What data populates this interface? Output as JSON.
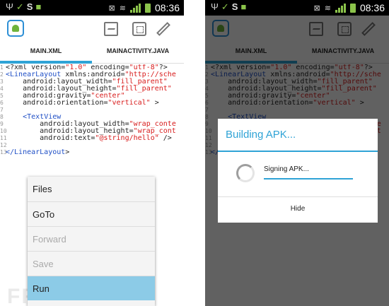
{
  "status_bar": {
    "time": "08:36",
    "icons": [
      "usb-icon",
      "check-icon",
      "s-icon",
      "bag-icon",
      "mute-icon",
      "wifi-icon",
      "signal-icon",
      "battery-icon"
    ]
  },
  "action_bar": {
    "app_icon": "android-braces-icon",
    "actions": [
      "image-icon",
      "screenshot-icon",
      "pencil-icon"
    ]
  },
  "tabs": [
    {
      "label": "MAIN.XML",
      "selected": true
    },
    {
      "label": "MAINACTIVITY.JAVA",
      "selected": false
    }
  ],
  "editor": {
    "lines": [
      {
        "num": "1",
        "code": "<?xml version=\"1.0\" encoding=\"utf-8\"?>"
      },
      {
        "num": "2",
        "code": "<LinearLayout xmlns:android=\"http://sche"
      },
      {
        "num": "3",
        "code": "    android:layout_width=\"fill_parent\""
      },
      {
        "num": "4",
        "code": "    android:layout_height=\"fill_parent\""
      },
      {
        "num": "5",
        "code": "    android:gravity=\"center\""
      },
      {
        "num": "6",
        "code": "    android:orientation=\"vertical\" >"
      },
      {
        "num": "7",
        "code": ""
      },
      {
        "num": "8",
        "code": "    <TextView"
      },
      {
        "num": "9",
        "code": "        android:layout_width=\"wrap_conte"
      },
      {
        "num": "10",
        "code": "        android:layout_height=\"wrap_cont"
      },
      {
        "num": "11",
        "code": "        android:text=\"@string/hello\" />"
      },
      {
        "num": "12",
        "code": ""
      },
      {
        "num": "13",
        "code": "</LinearLayout>"
      }
    ]
  },
  "menu": {
    "items": [
      {
        "label": "Files",
        "enabled": true
      },
      {
        "label": "GoTo",
        "enabled": true
      },
      {
        "label": "Forward",
        "enabled": false
      },
      {
        "label": "Save",
        "enabled": false
      },
      {
        "label": "Run",
        "enabled": true,
        "highlighted": true
      }
    ]
  },
  "watermark": "FREEBUF",
  "dialog": {
    "title": "Building APK...",
    "message": "Signing APK...",
    "progress": 1.0,
    "button": "Hide"
  },
  "colors": {
    "accent": "#2fa3d6",
    "tag": "#1f4fc6",
    "string": "#d81b1b",
    "menu_highlight": "#8ccbe7"
  }
}
